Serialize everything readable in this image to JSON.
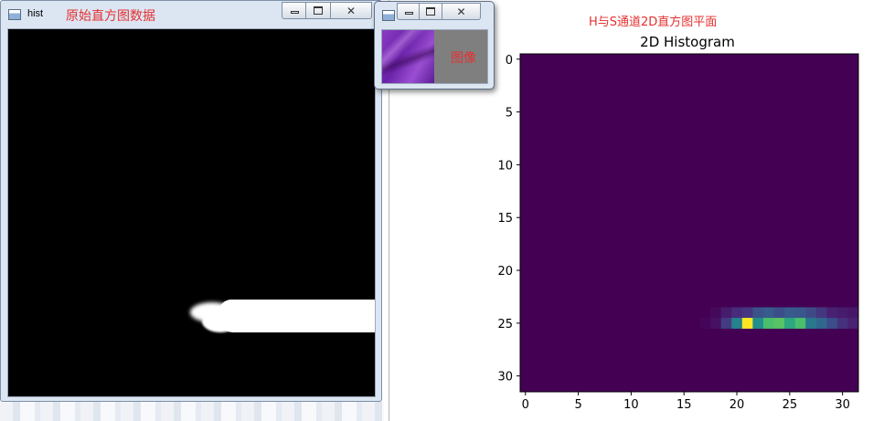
{
  "hist_window": {
    "title": "hist",
    "annotation": "原始直方图数据",
    "icon": "window-app-icon",
    "controls": [
      "minimize-icon",
      "maximize-icon",
      "close-icon"
    ],
    "close_glyph": "✕"
  },
  "image_window": {
    "annotation": "图像",
    "icon": "window-app-icon",
    "controls": [
      "minimize-icon",
      "maximize-icon",
      "close-icon"
    ],
    "close_glyph": "✕"
  },
  "figure": {
    "annotation": "H与S通道2D直方图平面",
    "background": "#ffffff"
  },
  "colors": {
    "annotation_red": "#e53131",
    "viridis_low": "#440154",
    "viridis_high": "#fde725",
    "hist_background": "#000000",
    "hist_foreground": "#ffffff"
  },
  "chart_data": {
    "type": "heatmap",
    "title": "2D Histogram",
    "colormap": "viridis",
    "rows": 32,
    "cols": 32,
    "xlim": [
      -0.5,
      31.5
    ],
    "ylim": [
      31.5,
      -0.5
    ],
    "x_ticks": [
      0,
      5,
      10,
      15,
      20,
      25,
      30
    ],
    "y_ticks": [
      0,
      5,
      10,
      15,
      20,
      25,
      30
    ],
    "x_tick_labels": [
      "0",
      "5",
      "10",
      "15",
      "20",
      "25",
      "30"
    ],
    "y_tick_labels": [
      "0",
      "5",
      "10",
      "15",
      "20",
      "25",
      "30"
    ],
    "grid": false,
    "value_range": [
      0,
      1
    ],
    "cells": [
      {
        "row": 24,
        "col": 18,
        "value": 0.03
      },
      {
        "row": 24,
        "col": 19,
        "value": 0.1
      },
      {
        "row": 24,
        "col": 20,
        "value": 0.16
      },
      {
        "row": 24,
        "col": 21,
        "value": 0.2
      },
      {
        "row": 24,
        "col": 22,
        "value": 0.32
      },
      {
        "row": 24,
        "col": 23,
        "value": 0.36
      },
      {
        "row": 24,
        "col": 24,
        "value": 0.3
      },
      {
        "row": 24,
        "col": 25,
        "value": 0.36
      },
      {
        "row": 24,
        "col": 26,
        "value": 0.34
      },
      {
        "row": 24,
        "col": 27,
        "value": 0.28
      },
      {
        "row": 24,
        "col": 28,
        "value": 0.2
      },
      {
        "row": 24,
        "col": 29,
        "value": 0.12
      },
      {
        "row": 24,
        "col": 30,
        "value": 0.1
      },
      {
        "row": 24,
        "col": 31,
        "value": 0.08
      },
      {
        "row": 25,
        "col": 17,
        "value": 0.02
      },
      {
        "row": 25,
        "col": 18,
        "value": 0.06
      },
      {
        "row": 25,
        "col": 19,
        "value": 0.22
      },
      {
        "row": 25,
        "col": 20,
        "value": 0.55
      },
      {
        "row": 25,
        "col": 21,
        "value": 1.0
      },
      {
        "row": 25,
        "col": 22,
        "value": 0.62
      },
      {
        "row": 25,
        "col": 23,
        "value": 0.78
      },
      {
        "row": 25,
        "col": 24,
        "value": 0.8
      },
      {
        "row": 25,
        "col": 25,
        "value": 0.7
      },
      {
        "row": 25,
        "col": 26,
        "value": 0.78
      },
      {
        "row": 25,
        "col": 27,
        "value": 0.5
      },
      {
        "row": 25,
        "col": 28,
        "value": 0.42
      },
      {
        "row": 25,
        "col": 29,
        "value": 0.3
      },
      {
        "row": 25,
        "col": 30,
        "value": 0.18
      },
      {
        "row": 25,
        "col": 31,
        "value": 0.12
      }
    ]
  }
}
